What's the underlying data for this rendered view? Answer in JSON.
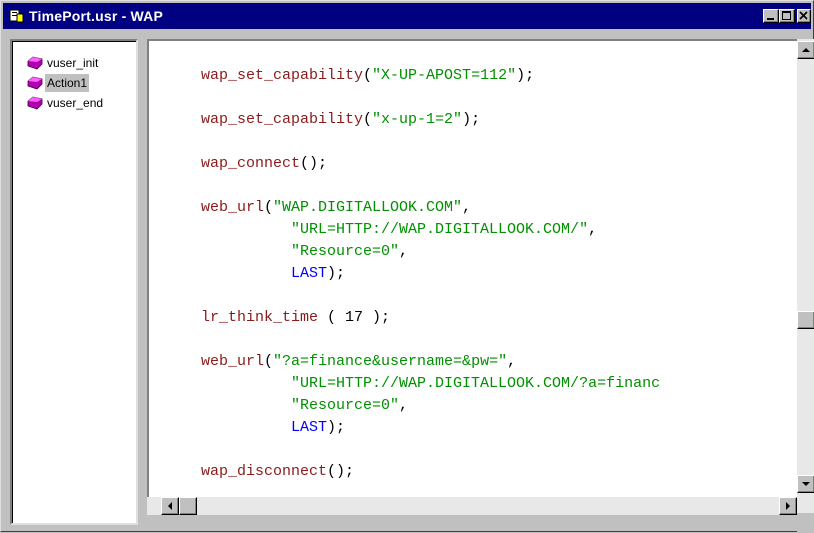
{
  "window": {
    "title": "TimePort.usr - WAP",
    "colors": {
      "titlebar": "#000080",
      "function": "#8b1a1a",
      "string": "#009000",
      "keyword": "#0000ff"
    }
  },
  "tree": {
    "items": [
      {
        "label": "vuser_init",
        "icon": "script-gem-icon",
        "selected": false
      },
      {
        "label": "Action1",
        "icon": "script-gem-icon",
        "selected": true
      },
      {
        "label": "vuser_end",
        "icon": "script-gem-icon",
        "selected": false
      }
    ]
  },
  "code": {
    "l1": {
      "fn": "wap_set_capability",
      "open": "(",
      "str": "\"X-UP-APOST=112\"",
      "close": ");"
    },
    "l2": {
      "fn": "wap_set_capability",
      "open": "(",
      "str": "\"x-up-1=2\"",
      "close": ");"
    },
    "l3": {
      "fn": "wap_connect",
      "rest": "();"
    },
    "l4": {
      "fn": "web_url",
      "open": "(",
      "str": "\"WAP.DIGITALLOOK.COM\"",
      "close": ","
    },
    "l5": {
      "indent": "          ",
      "str": "\"URL=HTTP://WAP.DIGITALLOOK.COM/\"",
      "close": ","
    },
    "l6": {
      "indent": "          ",
      "str": "\"Resource=0\"",
      "close": ","
    },
    "l7": {
      "indent": "          ",
      "kw": "LAST",
      "close": ");"
    },
    "l8": {
      "fn": "lr_think_time",
      "rest": " ( 17 );"
    },
    "l9": {
      "fn": "web_url",
      "open": "(",
      "str": "\"?a=finance&username=&pw=\"",
      "close": ","
    },
    "l10": {
      "indent": "          ",
      "str": "\"URL=HTTP://WAP.DIGITALLOOK.COM/?a=financ"
    },
    "l11": {
      "indent": "          ",
      "str": "\"Resource=0\"",
      "close": ","
    },
    "l12": {
      "indent": "          ",
      "kw": "LAST",
      "close": ");"
    },
    "l13": {
      "fn": "wap_disconnect",
      "rest": "();"
    }
  },
  "scrollbar": {
    "vertical_position_fraction": 0.6
  }
}
